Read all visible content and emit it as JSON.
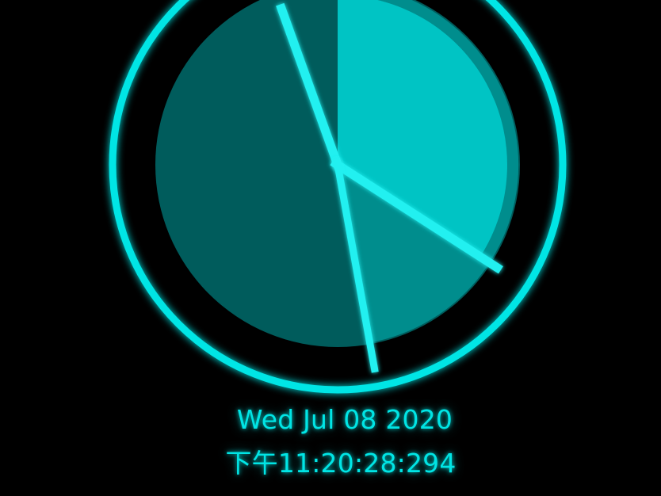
{
  "clock": {
    "date_text": "Wed Jul 08 2020",
    "time_text": "下午11:20:28:294",
    "hours": 11,
    "minutes": 20,
    "seconds": 28,
    "milliseconds": 294
  },
  "colors": {
    "background": "#000000",
    "glow": "#00e5e5",
    "hour_sector": "#00e3e3",
    "minute_sector": "#00c4c4",
    "second_sector": "#008d8d",
    "inner_rim": "#00a8a8"
  }
}
